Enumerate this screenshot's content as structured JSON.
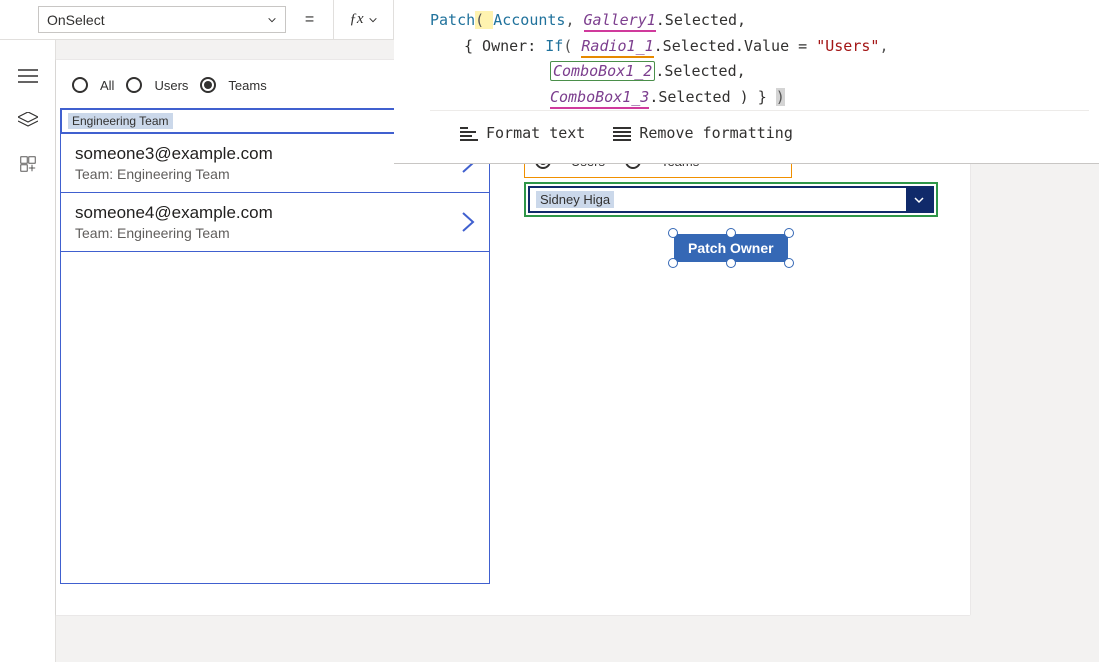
{
  "property_dropdown": {
    "value": "OnSelect"
  },
  "equals": "=",
  "fx_label": "ƒx",
  "formula": {
    "fn1": "Patch",
    "lparen1": "( ",
    "arg_accounts": "Accounts",
    "comma1": ", ",
    "gallery1": "Gallery1",
    "dot_selected1": ".Selected,",
    "line2_open": "{ Owner: ",
    "if_kw": "If",
    "lparen2": "( ",
    "radio1": "Radio1_1",
    "dot_sel_val": ".Selected.Value = ",
    "str_users": "\"Users\"",
    "comma2": ",",
    "combo2": "ComboBox1_2",
    "dot_selected2": ".Selected,",
    "combo3": "ComboBox1_3",
    "dot_selected3": ".Selected ) } ",
    "rparen_final": ")"
  },
  "formula_toolbar": {
    "format": "Format text",
    "remove": "Remove formatting"
  },
  "left_radio": {
    "all": "All",
    "users": "Users",
    "teams": "Teams",
    "selected": "teams"
  },
  "left_combo": {
    "value": "Engineering Team"
  },
  "gallery_items": [
    {
      "title": "someone3@example.com",
      "sub": "Team: Engineering Team"
    },
    {
      "title": "someone4@example.com",
      "sub": "Team: Engineering Team"
    }
  ],
  "right_radio": {
    "users": "Users",
    "teams": "Teams",
    "selected": "users"
  },
  "right_combo": {
    "value": "Sidney Higa"
  },
  "patch_button": {
    "label": "Patch Owner"
  }
}
